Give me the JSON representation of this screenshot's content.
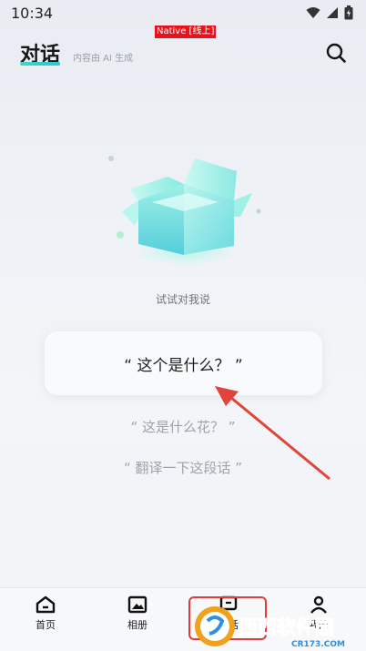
{
  "status_bar": {
    "time": "10:34"
  },
  "debug_badge": "Native [线上]",
  "header": {
    "title": "对话",
    "subtitle": "内容由 AI 生成"
  },
  "main": {
    "hint": "试试对我说",
    "prompt_card": "“ 这个是什么？ ”",
    "suggestions": [
      "“ 这是什么花？ ”",
      "“ 翻译一下这段话 ”"
    ]
  },
  "bottom_nav": {
    "items": [
      {
        "label": "首页",
        "icon": "home-icon"
      },
      {
        "label": "相册",
        "icon": "album-icon"
      },
      {
        "label": "对话",
        "icon": "chat-icon"
      },
      {
        "label": "我的",
        "icon": "profile-icon"
      }
    ]
  },
  "watermark": {
    "text": "西西软件园",
    "url": "CR173.COM"
  },
  "colors": {
    "accent": "#3fd6c3",
    "annotation": "#e0443a"
  }
}
